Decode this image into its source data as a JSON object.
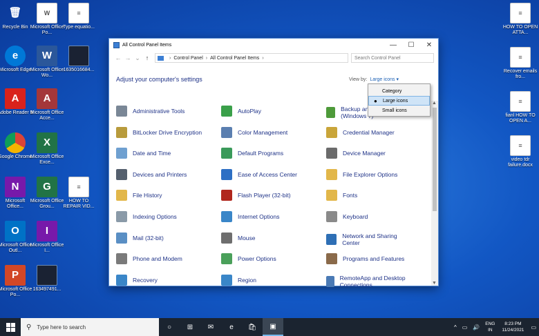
{
  "desktop": {
    "left_icons": [
      {
        "label": "Recycle Bin",
        "icon": "recycle-bin-icon",
        "glyph": "🗑"
      },
      {
        "label": "Microsoft Office Po...",
        "icon": "document-icon",
        "glyph": "W"
      },
      {
        "label": "Type equatio...",
        "icon": "document-icon",
        "glyph": "≡"
      },
      {
        "label": "Microsoft Edge",
        "icon": "edge-icon",
        "glyph": "e"
      },
      {
        "label": "Microsoft Office Wo...",
        "icon": "word-icon",
        "glyph": "W"
      },
      {
        "label": "1635016684...",
        "icon": "image-icon",
        "glyph": ""
      },
      {
        "label": "Adobe Reader 9",
        "icon": "pdf-icon",
        "glyph": "A"
      },
      {
        "label": "Microsoft Office Acce...",
        "icon": "access-icon",
        "glyph": "A"
      },
      {
        "label": "Google Chrome",
        "icon": "chrome-icon",
        "glyph": ""
      },
      {
        "label": "Microsoft Office Exce...",
        "icon": "excel-icon",
        "glyph": "X"
      },
      {
        "label": "Microsoft Office...",
        "icon": "onenote-icon",
        "glyph": "N"
      },
      {
        "label": "Microsoft Office Grou...",
        "icon": "groove-icon",
        "glyph": "G"
      },
      {
        "label": "HOW TO REPAIR VID...",
        "icon": "document-icon",
        "glyph": "≡"
      },
      {
        "label": "Microsoft Office Outl...",
        "icon": "outlook-icon",
        "glyph": "O"
      },
      {
        "label": "Microsoft Office I...",
        "icon": "infopath-icon",
        "glyph": "I"
      },
      {
        "label": "Microsoft Office Po...",
        "icon": "powerpoint-icon",
        "glyph": "P"
      },
      {
        "label": "163497491...",
        "icon": "image-icon",
        "glyph": ""
      }
    ],
    "right_icons": [
      {
        "label": "HOW TO OPEN ATTA...",
        "icon": "document-icon",
        "glyph": "≡"
      },
      {
        "label": "Recover emails fro...",
        "icon": "document-icon",
        "glyph": "≡"
      },
      {
        "label": "fianl HOW TO OPEN A...",
        "icon": "document-icon",
        "glyph": "≡"
      },
      {
        "label": "video tdr failure.docx",
        "icon": "document-icon",
        "glyph": "≡"
      }
    ]
  },
  "window": {
    "title": "All Control Panel Items",
    "buttons": {
      "minimize": "—",
      "maximize": "☐",
      "close": "✕"
    },
    "nav": {
      "back": "←",
      "forward": "→",
      "recent": "⌄",
      "up": "↑"
    },
    "breadcrumb": [
      "Control Panel",
      "All Control Panel Items"
    ],
    "breadcrumb_sep": "›",
    "search_placeholder": "Search Control Panel",
    "heading": "Adjust your computer's settings",
    "view_by_label": "View by:",
    "view_by_value": "Large icons ▾",
    "view_menu": [
      {
        "label": "Category",
        "selected": false
      },
      {
        "label": "Large icons",
        "selected": true
      },
      {
        "label": "Small icons",
        "selected": false
      }
    ],
    "items": [
      {
        "label": "Administrative Tools",
        "icon": "administrative-tools-icon",
        "color": "#7a8796",
        "col": 0
      },
      {
        "label": "AutoPlay",
        "icon": "autoplay-icon",
        "color": "#3aa04a",
        "col": 1
      },
      {
        "label": "Backup and Restore (Windows 7)",
        "icon": "backup-icon",
        "color": "#4e9a3a",
        "col": 2
      },
      {
        "label": "BitLocker Drive Encryption",
        "icon": "bitlocker-icon",
        "color": "#b89b3c",
        "col": 0
      },
      {
        "label": "Color Management",
        "icon": "color-management-icon",
        "color": "#5b7fb0",
        "col": 1
      },
      {
        "label": "Credential Manager",
        "icon": "credential-manager-icon",
        "color": "#c9a53a",
        "col": 2
      },
      {
        "label": "Date and Time",
        "icon": "date-time-icon",
        "color": "#6fa0d0",
        "col": 0
      },
      {
        "label": "Default Programs",
        "icon": "default-programs-icon",
        "color": "#3a9a5a",
        "col": 1
      },
      {
        "label": "Device Manager",
        "icon": "device-manager-icon",
        "color": "#6b6b6b",
        "col": 2
      },
      {
        "label": "Devices and Printers",
        "icon": "devices-printers-icon",
        "color": "#55606e",
        "col": 0
      },
      {
        "label": "Ease of Access Center",
        "icon": "ease-of-access-icon",
        "color": "#2d6fc4",
        "col": 1
      },
      {
        "label": "File Explorer Options",
        "icon": "folder-options-icon",
        "color": "#e2b74a",
        "col": 2
      },
      {
        "label": "File History",
        "icon": "file-history-icon",
        "color": "#e2b74a",
        "col": 0
      },
      {
        "label": "Flash Player (32-bit)",
        "icon": "flash-player-icon",
        "color": "#b0271e",
        "col": 1
      },
      {
        "label": "Fonts",
        "icon": "fonts-icon",
        "color": "#e2b74a",
        "col": 2
      },
      {
        "label": "Indexing Options",
        "icon": "indexing-options-icon",
        "color": "#8a9aa8",
        "col": 0
      },
      {
        "label": "Internet Options",
        "icon": "internet-options-icon",
        "color": "#3a86c8",
        "col": 1
      },
      {
        "label": "Keyboard",
        "icon": "keyboard-icon",
        "color": "#8a8a8a",
        "col": 2
      },
      {
        "label": "Mail (32-bit)",
        "icon": "mail-icon",
        "color": "#5a8fc4",
        "col": 0
      },
      {
        "label": "Mouse",
        "icon": "mouse-icon",
        "color": "#6e6e6e",
        "col": 1
      },
      {
        "label": "Network and Sharing Center",
        "icon": "network-sharing-icon",
        "color": "#2e6fb5",
        "col": 2
      },
      {
        "label": "Phone and Modem",
        "icon": "phone-modem-icon",
        "color": "#7a7a7a",
        "col": 0
      },
      {
        "label": "Power Options",
        "icon": "power-options-icon",
        "color": "#4aa05a",
        "col": 1
      },
      {
        "label": "Programs and Features",
        "icon": "programs-features-icon",
        "color": "#8a6a4a",
        "col": 2
      },
      {
        "label": "Recovery",
        "icon": "recovery-icon",
        "color": "#3a86c8",
        "col": 0
      },
      {
        "label": "Region",
        "icon": "region-icon",
        "color": "#3a86c8",
        "col": 1
      },
      {
        "label": "RemoteApp and Desktop Connections",
        "icon": "remoteapp-icon",
        "color": "#4a7ab5",
        "col": 2
      }
    ]
  },
  "taskbar": {
    "search_placeholder": "Type here to search",
    "pinned": [
      {
        "name": "task-view-icon",
        "glyph": "○"
      },
      {
        "name": "timeline-icon",
        "glyph": "⊞"
      },
      {
        "name": "mail-app-icon",
        "glyph": "✉"
      },
      {
        "name": "edge-taskbar-icon",
        "glyph": "e"
      },
      {
        "name": "store-icon",
        "glyph": "🛍"
      },
      {
        "name": "control-panel-taskbar-icon",
        "glyph": "▣"
      }
    ],
    "tray": {
      "chevron": "^",
      "network": "▭",
      "volume": "🔊",
      "lang_line1": "ENG",
      "lang_line2": "IN"
    },
    "time": "8:23 PM",
    "date": "11/24/2021",
    "notifications": "▭"
  }
}
